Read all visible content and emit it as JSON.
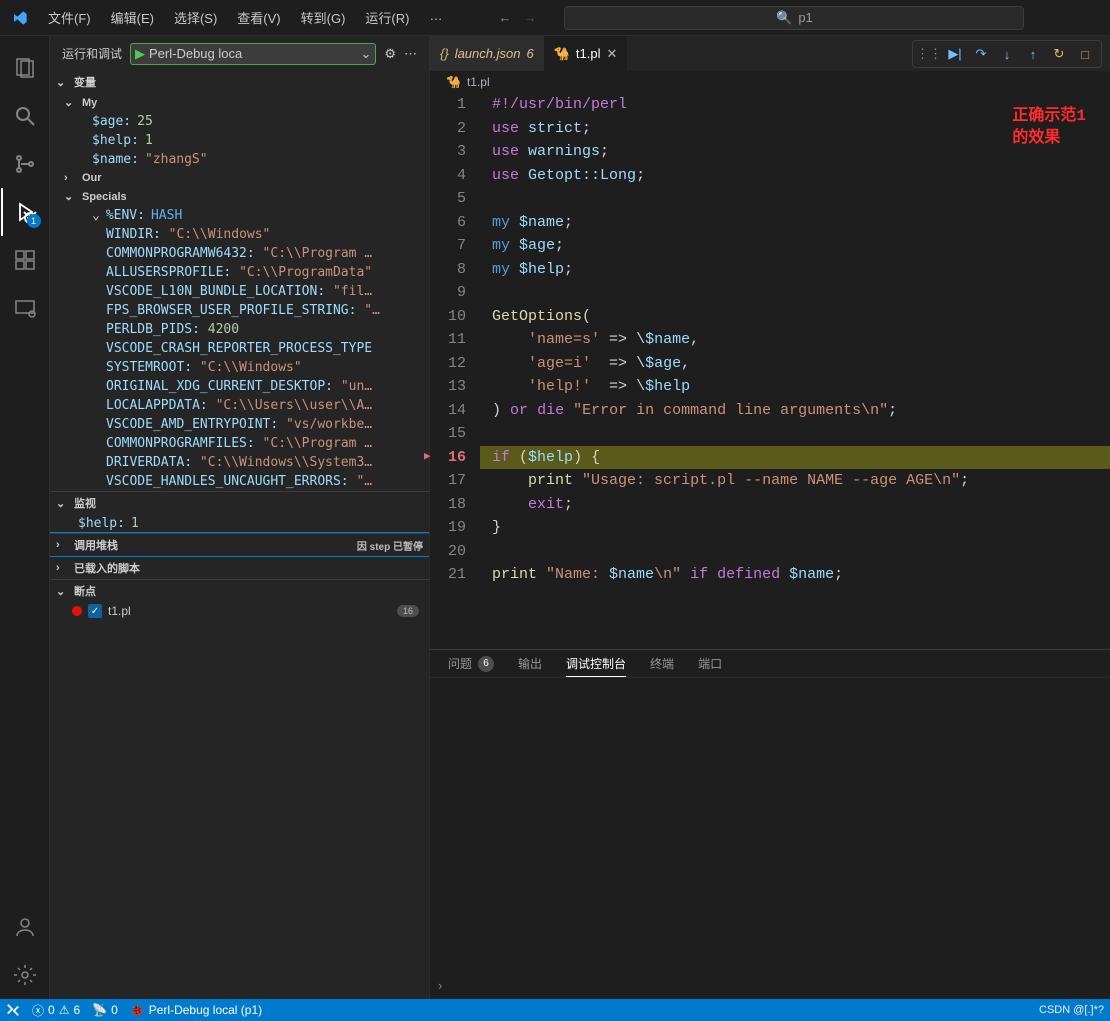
{
  "titlebar": {
    "menus": [
      "文件(F)",
      "编辑(E)",
      "选择(S)",
      "查看(V)",
      "转到(G)",
      "运行(R)",
      "…"
    ],
    "search_icon": "🔍",
    "search_text": "p1"
  },
  "sidebar": {
    "title": "运行和调试",
    "config": "Perl-Debug loca",
    "sections": {
      "variables": "变量",
      "my": "My",
      "our": "Our",
      "specials": "Specials",
      "env": "%ENV:",
      "env_type": "HASH",
      "watch": "监视",
      "callstack": "调用堆栈",
      "callstack_status": "因 step 已暂停",
      "loaded": "已载入的脚本",
      "breakpoints": "断点"
    },
    "vars_my": [
      {
        "k": "$age:",
        "v": "25",
        "t": "num"
      },
      {
        "k": "$help:",
        "v": "1",
        "t": "num"
      },
      {
        "k": "$name:",
        "v": "\"zhangS\"",
        "t": "str"
      }
    ],
    "env_vars": [
      {
        "k": "WINDIR:",
        "v": "\"C:\\\\Windows\""
      },
      {
        "k": "COMMONPROGRAMW6432:",
        "v": "\"C:\\\\Program …"
      },
      {
        "k": "ALLUSERSPROFILE:",
        "v": "\"C:\\\\ProgramData\""
      },
      {
        "k": "VSCODE_L10N_BUNDLE_LOCATION:",
        "v": "\"fil…"
      },
      {
        "k": "FPS_BROWSER_USER_PROFILE_STRING:",
        "v": "\"…"
      },
      {
        "k": "PERLDB_PIDS:",
        "v": "4200",
        "t": "num"
      },
      {
        "k": "VSCODE_CRASH_REPORTER_PROCESS_TYPE",
        "v": ""
      },
      {
        "k": "SYSTEMROOT:",
        "v": "\"C:\\\\Windows\""
      },
      {
        "k": "ORIGINAL_XDG_CURRENT_DESKTOP:",
        "v": "\"un…"
      },
      {
        "k": "LOCALAPPDATA:",
        "v": "\"C:\\\\Users\\\\user\\\\A…"
      },
      {
        "k": "VSCODE_AMD_ENTRYPOINT:",
        "v": "\"vs/workbe…"
      },
      {
        "k": "COMMONPROGRAMFILES:",
        "v": "\"C:\\\\Program …"
      },
      {
        "k": "DRIVERDATA:",
        "v": "\"C:\\\\Windows\\\\System3…"
      },
      {
        "k": "VSCODE_HANDLES_UNCAUGHT_ERRORS:",
        "v": "\"…"
      }
    ],
    "watch_items": [
      {
        "k": "$help:",
        "v": "1"
      }
    ],
    "breakpoint_file": "t1.pl",
    "breakpoint_line": "16"
  },
  "activity_badge": "1",
  "tabs": {
    "launch": "launch.json",
    "launch_count": "6",
    "t1": "t1.pl"
  },
  "breadcrumb": {
    "file": "t1.pl"
  },
  "annotation": {
    "l1": "正确示范1",
    "l2": "的效果"
  },
  "code": [
    {
      "n": "1",
      "html": "<span class='tok-shebang'>#!/usr/bin/perl</span>"
    },
    {
      "n": "2",
      "html": "<span class='tok-kw'>use</span> <span class='tok-var'>strict</span><span class='tok-punc'>;</span>"
    },
    {
      "n": "3",
      "html": "<span class='tok-kw'>use</span> <span class='tok-var'>warnings</span><span class='tok-punc'>;</span>"
    },
    {
      "n": "4",
      "html": "<span class='tok-kw'>use</span> <span class='tok-var'>Getopt::Long</span><span class='tok-punc'>;</span>"
    },
    {
      "n": "5",
      "html": ""
    },
    {
      "n": "6",
      "html": "<span class='tok-kw2'>my</span> <span class='tok-var'>$name</span><span class='tok-punc'>;</span>"
    },
    {
      "n": "7",
      "html": "<span class='tok-kw2'>my</span> <span class='tok-var'>$age</span><span class='tok-punc'>;</span>"
    },
    {
      "n": "8",
      "html": "<span class='tok-kw2'>my</span> <span class='tok-var'>$help</span><span class='tok-punc'>;</span>"
    },
    {
      "n": "9",
      "html": ""
    },
    {
      "n": "10",
      "html": "<span class='tok-fn'>GetOptions</span><span class='tok-punc'>(</span>"
    },
    {
      "n": "11",
      "html": "    <span class='tok-str'>'name=s'</span> <span class='tok-op'>=&gt;</span> <span class='tok-op'>\\</span><span class='tok-var'>$name</span><span class='tok-punc'>,</span>"
    },
    {
      "n": "12",
      "html": "    <span class='tok-str'>'age=i'</span>  <span class='tok-op'>=&gt;</span> <span class='tok-op'>\\</span><span class='tok-var'>$age</span><span class='tok-punc'>,</span>"
    },
    {
      "n": "13",
      "html": "    <span class='tok-str'>'help!'</span>  <span class='tok-op'>=&gt;</span> <span class='tok-op'>\\</span><span class='tok-var'>$help</span>"
    },
    {
      "n": "14",
      "html": "<span class='tok-punc'>)</span> <span class='tok-kw'>or</span> <span class='tok-kw'>die</span> <span class='tok-str'>\"Error in command line arguments\\n\"</span><span class='tok-punc'>;</span>"
    },
    {
      "n": "15",
      "html": ""
    },
    {
      "n": "16",
      "html": "<span class='tok-kw'>if</span> <span class='tok-punc'>(</span><span class='tok-var'>$help</span><span class='tok-punc'>)</span> <span class='tok-punc'>{</span>",
      "hl": true,
      "cur": true
    },
    {
      "n": "17",
      "html": "    <span class='tok-fn'>print</span> <span class='tok-str'>\"Usage: script.pl --name NAME --age AGE\\n\"</span><span class='tok-punc'>;</span>"
    },
    {
      "n": "18",
      "html": "    <span class='tok-kw'>exit</span><span class='tok-punc'>;</span>"
    },
    {
      "n": "19",
      "html": "<span class='tok-punc'>}</span>"
    },
    {
      "n": "20",
      "html": ""
    },
    {
      "n": "21",
      "html": "<span class='tok-fn'>print</span> <span class='tok-str'>\"Name: <span class='tok-var'>$name</span>\\n\"</span> <span class='tok-kw'>if</span> <span class='tok-kw'>defined</span> <span class='tok-var'>$name</span><span class='tok-punc'>;</span>"
    }
  ],
  "panel": {
    "tabs": {
      "problems": "问题",
      "problems_count": "6",
      "output": "输出",
      "debug_console": "调试控制台",
      "terminal": "终端",
      "ports": "端口"
    }
  },
  "statusbar": {
    "errors": "0",
    "warnings": "6",
    "radio": "0",
    "debug": "Perl-Debug local (p1)",
    "watermark": "CSDN @[.]*?"
  }
}
